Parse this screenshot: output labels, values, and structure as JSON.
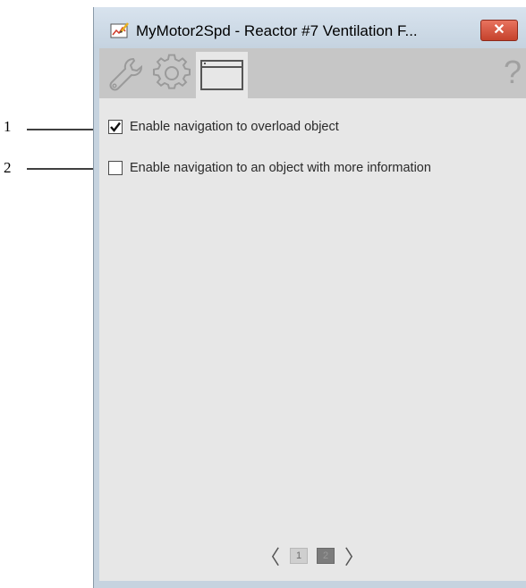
{
  "callouts": [
    {
      "number": "1"
    },
    {
      "number": "2"
    }
  ],
  "window": {
    "title": "MyMotor2Spd - Reactor #7 Ventilation F...",
    "close_label": "✕"
  },
  "toolbar": {
    "tabs": [
      {
        "icon": "wrench-icon",
        "active": false
      },
      {
        "icon": "gear-icon",
        "active": false
      },
      {
        "icon": "window-icon",
        "active": true
      }
    ],
    "help_label": "?"
  },
  "options": [
    {
      "label": "Enable navigation to overload object",
      "checked": true
    },
    {
      "label": "Enable navigation to an object with more information",
      "checked": false
    }
  ],
  "pager": {
    "prev_label": "〈",
    "next_label": "〉",
    "pages": [
      "1",
      "2"
    ],
    "current_page": "2"
  }
}
